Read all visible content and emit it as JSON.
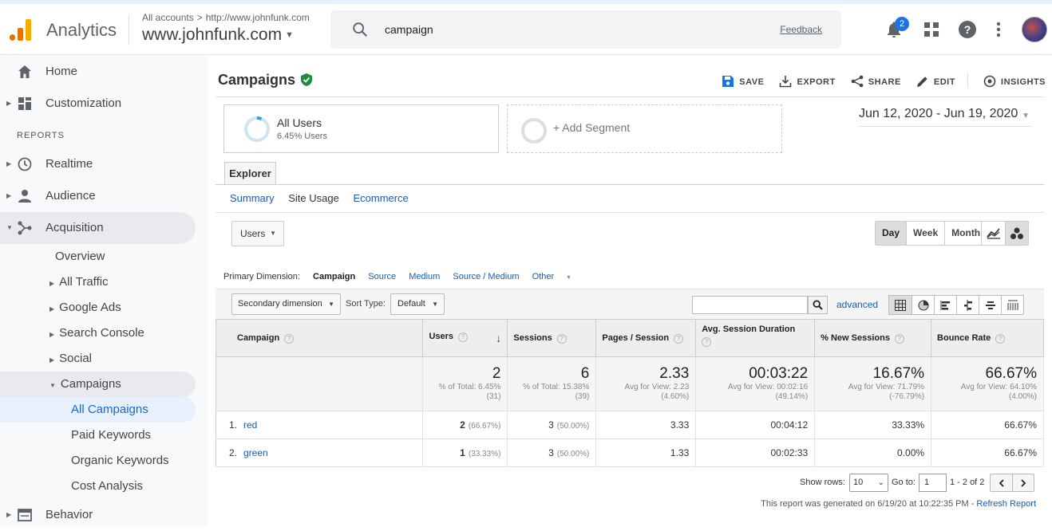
{
  "header": {
    "app_name": "Analytics",
    "breadcrumb_root": "All accounts",
    "breadcrumb_sep": ">",
    "breadcrumb_site": "http://www.johnfunk.com",
    "account": "www.johnfunk.com",
    "search_value": "campaign",
    "feedback": "Feedback",
    "notification_count": "2"
  },
  "sidebar": {
    "home": "Home",
    "customization": "Customization",
    "reports_heading": "REPORTS",
    "realtime": "Realtime",
    "audience": "Audience",
    "acquisition": "Acquisition",
    "overview": "Overview",
    "all_traffic": "All Traffic",
    "google_ads": "Google Ads",
    "search_console": "Search Console",
    "social": "Social",
    "campaigns": "Campaigns",
    "all_campaigns": "All Campaigns",
    "paid_keywords": "Paid Keywords",
    "organic_keywords": "Organic Keywords",
    "cost_analysis": "Cost Analysis",
    "behavior": "Behavior"
  },
  "page": {
    "title": "Campaigns",
    "actions": {
      "save": "SAVE",
      "export": "EXPORT",
      "share": "SHARE",
      "edit": "EDIT",
      "insights": "INSIGHTS"
    },
    "segment_name": "All Users",
    "segment_pct": "6.45% Users",
    "add_segment": "+ Add Segment",
    "date_range": "Jun 12, 2020 - Jun 19, 2020",
    "explorer_tab": "Explorer",
    "subtabs": [
      "Summary",
      "Site Usage",
      "Ecommerce"
    ],
    "metric_select": "Users",
    "periods": [
      "Day",
      "Week",
      "Month"
    ],
    "primary_dimension_label": "Primary Dimension:",
    "primary_dimensions": [
      "Campaign",
      "Source",
      "Medium",
      "Source / Medium",
      "Other"
    ],
    "secondary_dimension": "Secondary dimension",
    "sort_type_label": "Sort Type:",
    "sort_type": "Default",
    "advanced": "advanced"
  },
  "table": {
    "headers": [
      "Campaign",
      "Users",
      "Sessions",
      "Pages / Session",
      "Avg. Session Duration",
      "% New Sessions",
      "Bounce Rate"
    ],
    "totals": [
      {
        "value": "2",
        "l1": "% of Total: 6.45%",
        "l2": "(31)"
      },
      {
        "value": "6",
        "l1": "% of Total: 15.38%",
        "l2": "(39)"
      },
      {
        "value": "2.33",
        "l1": "Avg for View: 2.23",
        "l2": "(4.60%)"
      },
      {
        "value": "00:03:22",
        "l1": "Avg for View: 00:02:16",
        "l2": "(49.14%)"
      },
      {
        "value": "16.67%",
        "l1": "Avg for View: 71.79%",
        "l2": "(-76.79%)"
      },
      {
        "value": "66.67%",
        "l1": "Avg for View: 64.10%",
        "l2": "(4.00%)"
      }
    ],
    "rows": [
      {
        "idx": "1.",
        "name": "red",
        "users": "2",
        "users_pct": "(66.67%)",
        "sessions": "3",
        "sessions_pct": "(50.00%)",
        "pps": "3.33",
        "dur": "00:04:12",
        "new": "33.33%",
        "bounce": "66.67%"
      },
      {
        "idx": "2.",
        "name": "green",
        "users": "1",
        "users_pct": "(33.33%)",
        "sessions": "3",
        "sessions_pct": "(50.00%)",
        "pps": "1.33",
        "dur": "00:02:33",
        "new": "0.00%",
        "bounce": "66.67%"
      }
    ]
  },
  "pager": {
    "show_rows_label": "Show rows:",
    "show_rows": "10",
    "goto_label": "Go to:",
    "goto": "1",
    "range": "1 - 2 of 2",
    "generated": "This report was generated on 6/19/20 at 10:22:35 PM -",
    "refresh": "Refresh Report"
  },
  "colors": {
    "accent": "#1a73e8",
    "link": "#1a5bb0",
    "logo_orange": "#f9ab00",
    "logo_dark": "#e37400"
  }
}
